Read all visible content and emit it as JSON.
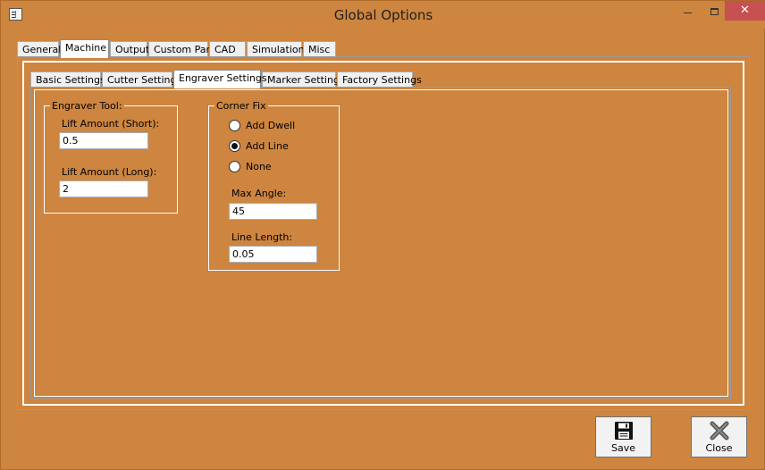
{
  "window": {
    "title": "Global Options",
    "icons": {
      "app": "form-icon",
      "minimize": "minimize-icon",
      "maximize": "maximize-icon",
      "close": "close-icon"
    },
    "close_glyph": "✕"
  },
  "main_tabs": {
    "active": "Machine",
    "items": [
      {
        "label": "General"
      },
      {
        "label": "Machine"
      },
      {
        "label": "Output"
      },
      {
        "label": "Custom Part"
      },
      {
        "label": "CAD"
      },
      {
        "label": "Simulation"
      },
      {
        "label": "Misc"
      }
    ]
  },
  "sub_tabs": {
    "active": "Engraver Settings",
    "items": [
      {
        "label": "Basic Settings"
      },
      {
        "label": "Cutter Settings"
      },
      {
        "label": "Engraver Settings"
      },
      {
        "label": "Marker Settings"
      },
      {
        "label": "Factory Settings"
      }
    ]
  },
  "engraver_tool": {
    "legend": "Engraver Tool:",
    "lift_short_label": "Lift Amount (Short):",
    "lift_short_value": "0.5",
    "lift_long_label": "Lift Amount (Long):",
    "lift_long_value": "2"
  },
  "corner_fix": {
    "legend": "Corner Fix",
    "options": [
      {
        "label": "Add Dwell",
        "checked": false
      },
      {
        "label": "Add Line",
        "checked": true
      },
      {
        "label": "None",
        "checked": false
      }
    ],
    "max_angle_label": "Max Angle:",
    "max_angle_value": "45",
    "line_length_label": "Line Length:",
    "line_length_value": "0.05"
  },
  "buttons": {
    "save_label": "Save",
    "save_icon": "floppy-disk-icon",
    "close_label": "Close",
    "close_icon": "x-close-icon"
  },
  "colors": {
    "background": "#cd853f",
    "close_button": "#c75050"
  }
}
